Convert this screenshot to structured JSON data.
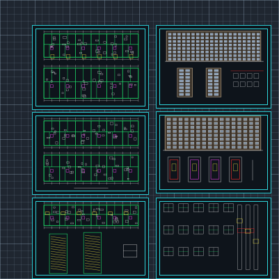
{
  "canvas": {
    "background": "#1f2630",
    "grid_color": "#5a6a7a"
  },
  "colors": {
    "frame": "#2fd6dc",
    "wall": "#1fe06a",
    "dim": "#e8e8e8",
    "accent_yellow": "#f0e040",
    "accent_magenta": "#e040e0",
    "accent_red": "#ff3030",
    "facade": "#c8b090"
  },
  "sheets": [
    {
      "id": "sheet-1",
      "kind": "floor-plan-pair",
      "label": ""
    },
    {
      "id": "sheet-2",
      "kind": "elevation-sections",
      "label": ""
    },
    {
      "id": "sheet-3",
      "kind": "floor-plan-pair",
      "label": ""
    },
    {
      "id": "sheet-4",
      "kind": "facade-details",
      "label": ""
    },
    {
      "id": "sheet-5",
      "kind": "plan-stairs",
      "label": ""
    },
    {
      "id": "sheet-6",
      "kind": "details",
      "label": ""
    }
  ]
}
